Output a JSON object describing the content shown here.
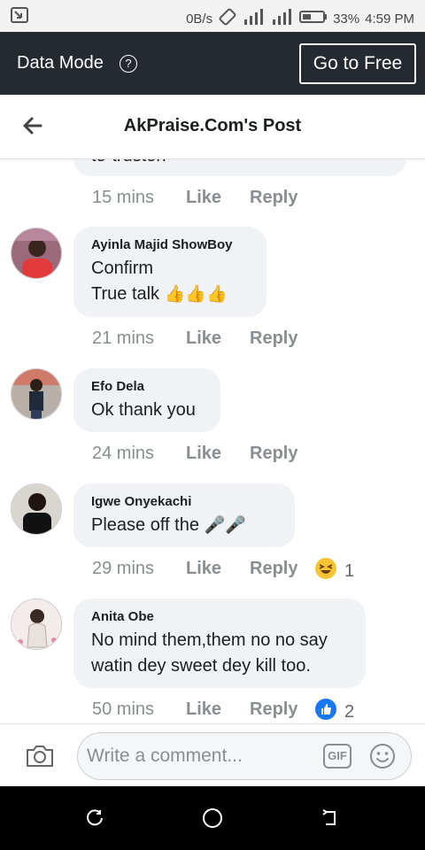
{
  "status_bar": {
    "data_speed": "0B/s",
    "battery": "33%",
    "time": "4:59 PM"
  },
  "data_mode": {
    "label": "Data Mode",
    "info_glyph": "?",
    "button_label": "Go to Free"
  },
  "header": {
    "title": "AkPraise.Com's Post"
  },
  "comments": [
    {
      "partial_text": "to-truston",
      "time": "15 mins",
      "like": "Like",
      "reply": "Reply"
    },
    {
      "author": "Ayinla Majid ShowBoy",
      "line1": "Confirm",
      "line2": "True talk",
      "emoji": "👍👍👍",
      "time": "21 mins",
      "like": "Like",
      "reply": "Reply"
    },
    {
      "author": "Efo Dela",
      "line1": "Ok thank you",
      "time": "24 mins",
      "like": "Like",
      "reply": "Reply"
    },
    {
      "author": "Igwe Onyekachi",
      "line1": "Please off the",
      "emoji": "🎤🎤",
      "time": "29 mins",
      "like": "Like",
      "reply": "Reply",
      "reaction_icon": "haha-icon",
      "reaction_count": "1"
    },
    {
      "author": "Anita Obe",
      "line1": "No mind them,them no no say",
      "line2": "watin dey sweet dey kill too.",
      "time": "50 mins",
      "like": "Like",
      "reply": "Reply",
      "reaction_icon": "like-reaction-icon",
      "reaction_count": "2"
    }
  ],
  "composer": {
    "placeholder": "Write a comment...",
    "gif_label": "GIF"
  },
  "colors": {
    "dark_bar": "#252a30",
    "bubble": "#f0f2f5",
    "meta_gray": "#8a8d91",
    "facebook_blue": "#1877f2"
  }
}
